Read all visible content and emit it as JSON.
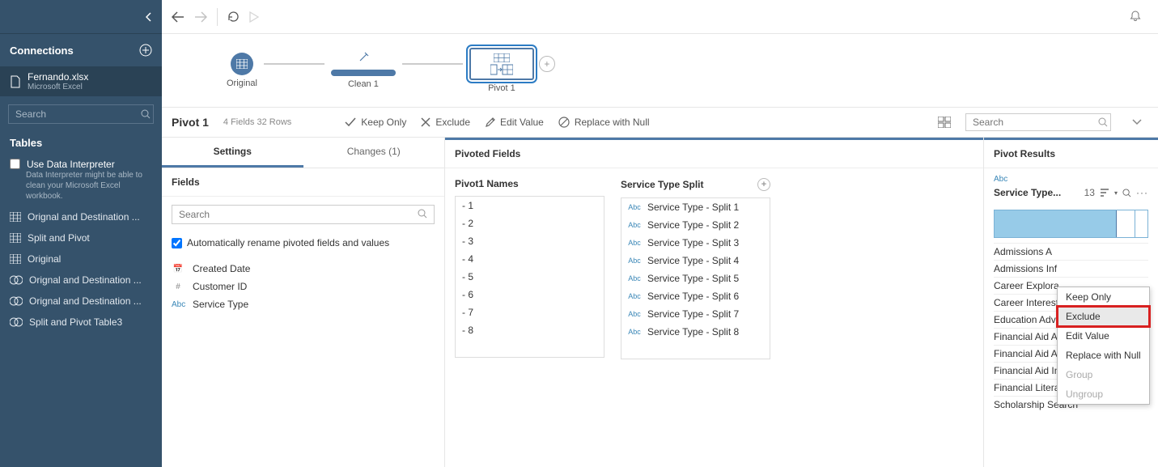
{
  "sidebar": {
    "connections_title": "Connections",
    "file": {
      "name": "Fernando.xlsx",
      "type": "Microsoft Excel"
    },
    "search_placeholder": "Search",
    "tables_title": "Tables",
    "data_interpreter": {
      "label": "Use Data Interpreter",
      "hint": "Data Interpreter might be able to clean your Microsoft Excel workbook."
    },
    "tables": [
      "Orignal and Destination ...",
      "Split and Pivot",
      "Original",
      "Orignal and Destination ...",
      "Orignal and Destination ...",
      "Split and Pivot Table3"
    ]
  },
  "flow": {
    "nodes": [
      "Original",
      "Clean 1",
      "Pivot 1"
    ]
  },
  "action_bar": {
    "title": "Pivot 1",
    "meta": "4 Fields  32 Rows",
    "keep_only": "Keep Only",
    "exclude": "Exclude",
    "edit_value": "Edit Value",
    "replace_null": "Replace with Null",
    "search_placeholder": "Search"
  },
  "left_panel": {
    "tabs": {
      "settings": "Settings",
      "changes": "Changes (1)"
    },
    "fields_title": "Fields",
    "search_placeholder": "Search",
    "auto_rename": "Automatically rename pivoted fields and values",
    "fields": [
      {
        "type": "date",
        "name": "Created Date"
      },
      {
        "type": "hash",
        "name": "Customer ID"
      },
      {
        "type": "abc",
        "name": "Service Type"
      }
    ]
  },
  "pivoted": {
    "title": "Pivoted Fields",
    "names_title": "Pivot1 Names",
    "split_title": "Service Type Split",
    "names": [
      " - 1",
      " - 2",
      " - 3",
      " - 4",
      " - 5",
      " - 6",
      " - 7",
      " - 8"
    ],
    "splits": [
      "Service Type - Split 1",
      "Service Type - Split 2",
      "Service Type - Split 3",
      "Service Type - Split 4",
      "Service Type - Split 5",
      "Service Type - Split 6",
      "Service Type - Split 7",
      "Service Type - Split 8"
    ]
  },
  "results": {
    "title": "Pivot Results",
    "type_glyph": "Abc",
    "field": "Service Type...",
    "count": "13",
    "values": [
      "Admissions A",
      "Admissions Inf",
      "Career Explora",
      "Career Interest",
      "Education Advi",
      "Financial Aid A",
      "Financial Aid Applicati...",
      "Financial Aid Info",
      "Financial Literacy",
      "Scholarship Search"
    ]
  },
  "context_menu": {
    "keep_only": "Keep Only",
    "exclude": "Exclude",
    "edit_value": "Edit Value",
    "replace_null": "Replace with Null",
    "group": "Group",
    "ungroup": "Ungroup"
  }
}
